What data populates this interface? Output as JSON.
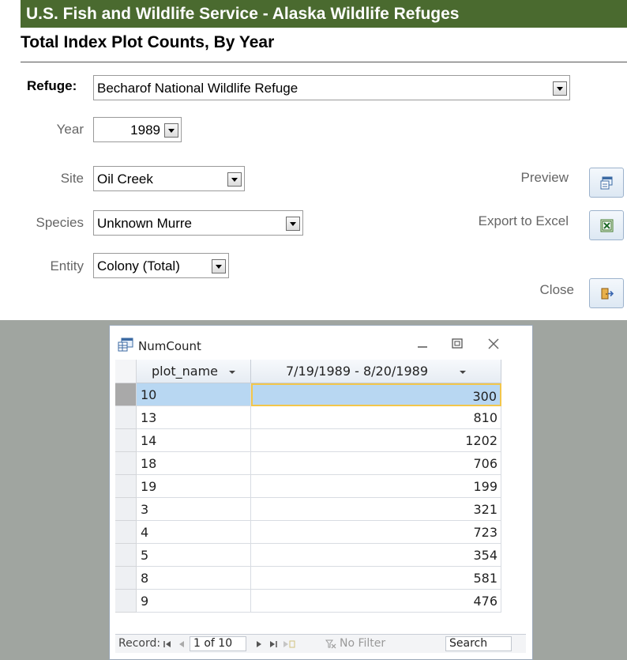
{
  "header": {
    "title": "U.S. Fish and Wildlife Service  - Alaska Wildlife Refuges",
    "subtitle": "Total Index Plot Counts, By Year"
  },
  "form": {
    "refuge_label": "Refuge:",
    "refuge_value": "Becharof National Wildlife Refuge",
    "year_label": "Year",
    "year_value": "1989",
    "site_label": "Site",
    "site_value": "Oil Creek",
    "species_label": "Species",
    "species_value": "Unknown Murre",
    "entity_label": "Entity",
    "entity_value": "Colony (Total)"
  },
  "actions": {
    "preview_label": "Preview",
    "export_label": "Export to Excel",
    "close_label": "Close"
  },
  "datasheet": {
    "title": "NumCount",
    "columns": [
      "plot_name",
      "7/19/1989 - 8/20/1989"
    ],
    "rows": [
      {
        "plot": "10",
        "count": "300"
      },
      {
        "plot": "13",
        "count": "810"
      },
      {
        "plot": "14",
        "count": "1202"
      },
      {
        "plot": "18",
        "count": "706"
      },
      {
        "plot": "19",
        "count": "199"
      },
      {
        "plot": "3",
        "count": "321"
      },
      {
        "plot": "4",
        "count": "723"
      },
      {
        "plot": "5",
        "count": "354"
      },
      {
        "plot": "8",
        "count": "581"
      },
      {
        "plot": "9",
        "count": "476"
      }
    ],
    "selected_row": 0,
    "nav": {
      "record_label": "Record:",
      "position": "1 of 10",
      "filter_label": "No Filter",
      "search_label": "Search"
    }
  },
  "colors": {
    "header_bg": "#4a6a2f",
    "selection": "#b8d7f2",
    "selection_border": "#f2c64b",
    "background_gray": "#a0a5a0"
  }
}
